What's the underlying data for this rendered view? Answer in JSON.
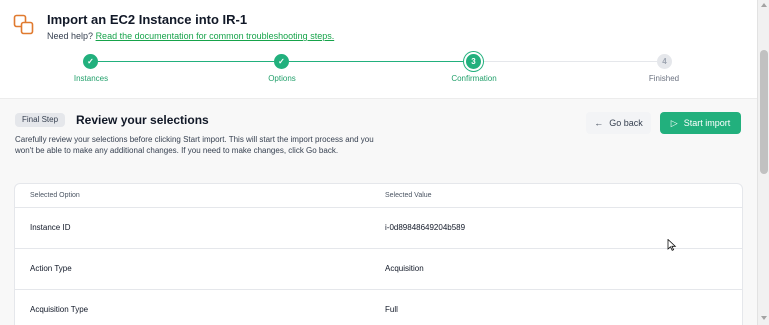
{
  "header": {
    "title": "Import an EC2 Instance into IR-1",
    "help_prefix": "Need help?",
    "help_link": "Read the documentation for common troubleshooting steps.",
    "icon": "copy-stack-icon"
  },
  "stepper": {
    "steps": [
      {
        "label": "Instances",
        "number": "1",
        "status": "done"
      },
      {
        "label": "Options",
        "number": "2",
        "status": "done"
      },
      {
        "label": "Confirmation",
        "number": "3",
        "status": "current"
      },
      {
        "label": "Finished",
        "number": "4",
        "status": "upcoming"
      }
    ],
    "check_glyph": "✓"
  },
  "review": {
    "badge": "Final Step",
    "title": "Review your selections",
    "description": "Carefully review your selections before clicking Start import. This will start the import process and you won't be able to make any additional changes. If you need to make changes, click Go back.",
    "go_back_label": "Go back",
    "start_import_label": "Start import",
    "arrow_glyph": "←",
    "play_glyph": "▷"
  },
  "table": {
    "headers": [
      "Selected Option",
      "Selected Value"
    ],
    "rows": [
      {
        "option": "Instance ID",
        "value": "i-0d89848649204b589"
      },
      {
        "option": "Action Type",
        "value": "Acquisition"
      },
      {
        "option": "Acquisition Type",
        "value": "Full"
      }
    ]
  },
  "colors": {
    "accent": "#22b07d",
    "link": "#16a34a",
    "upcoming": "#e5e7eb"
  }
}
